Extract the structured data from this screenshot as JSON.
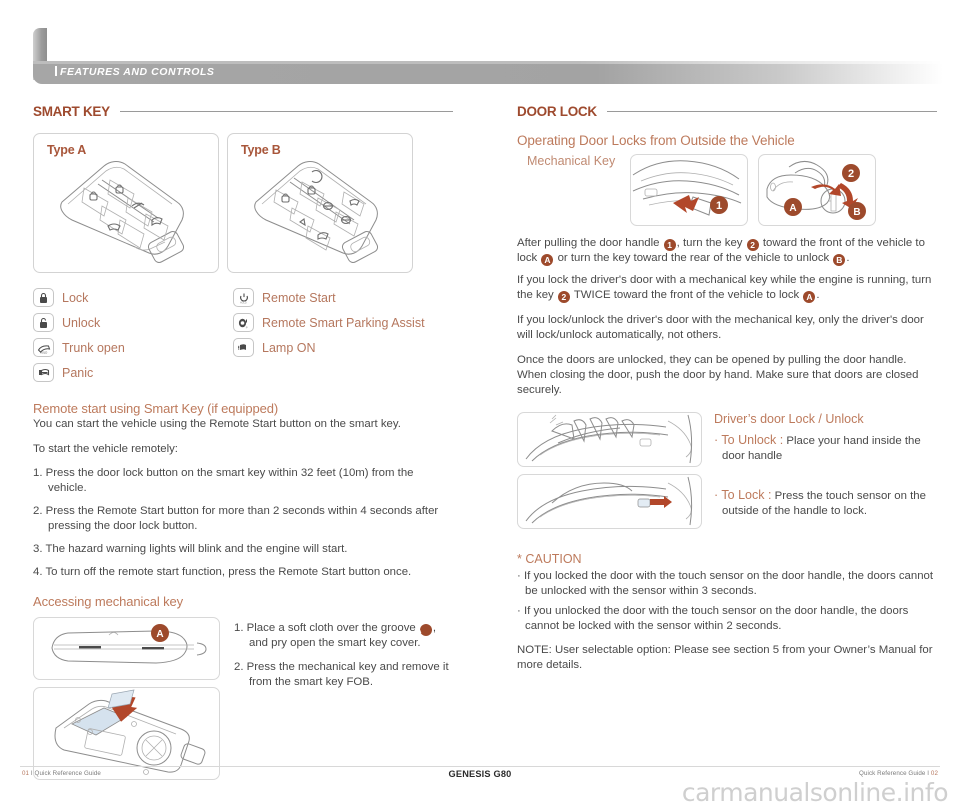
{
  "header": {
    "title": "FEATURES AND CONTROLS"
  },
  "left": {
    "section_title": "SMART KEY",
    "types": [
      {
        "label": "Type A"
      },
      {
        "label": "Type B"
      }
    ],
    "legend_col1": [
      {
        "icon": "lock-icon",
        "label": "Lock"
      },
      {
        "icon": "unlock-icon",
        "label": "Unlock"
      },
      {
        "icon": "trunk-open-icon",
        "label": "Trunk open"
      },
      {
        "icon": "panic-horn-icon",
        "label": "Panic"
      }
    ],
    "legend_col2": [
      {
        "icon": "remote-start-icon",
        "label": "Remote Start"
      },
      {
        "icon": "remote-smart-parking-assist-icon",
        "label": "Remote Smart Parking Assist"
      },
      {
        "icon": "lamp-on-icon",
        "label": "Lamp ON"
      }
    ],
    "remote_start": {
      "heading": "Remote start using Smart Key (if equipped)",
      "intro": "You can start the vehicle using the Remote Start button on the smart key.",
      "lead": "To start the vehicle remotely:",
      "steps": [
        "1. Press the door lock button on the smart key within 32 feet (10m) from the vehicle.",
        "2. Press the Remote Start button for more than 2 seconds within 4 seconds after pressing the door lock button.",
        "3. The hazard warning lights will blink and the engine will start.",
        "4. To turn off the remote start function, press the Remote Start button once."
      ]
    },
    "mechanical": {
      "heading": "Accessing mechanical key",
      "fig_badge": "A",
      "step1_pre": "1. Place a soft cloth over the groove",
      "step1_badge": "A",
      "step1_post": ", and pry open the smart key cover.",
      "step2": "2. Press the mechanical key and remove it from the smart key FOB."
    }
  },
  "right": {
    "section_title": "DOOR LOCK",
    "operating_title": "Operating Door Locks from Outside the Vehicle",
    "mechanical_key_label": "Mechanical Key",
    "fig_badges": {
      "one": "1",
      "two": "2",
      "a": "A",
      "b": "B"
    },
    "para1": {
      "t1": "After pulling the door handle ",
      "b1": "1",
      "t2": ", turn the key ",
      "b2": "2",
      "t3": " toward the front of the vehicle to lock ",
      "b3": "A",
      "t4": " or turn the key toward the rear of the vehicle to unlock ",
      "b4": "B",
      "t5": "."
    },
    "para2": {
      "t1": "If you lock the driver's door with a mechanical key while the engine is running, turn the key ",
      "b1": "2",
      "t2": " TWICE toward the front of the vehicle to lock ",
      "b2": "A",
      "t3": "."
    },
    "para3": "If you lock/unlock the driver's door with the mechanical key, only the driver's door will lock/unlock automatically, not others.",
    "para4": "Once the doors are unlocked, they can be opened by pulling the door handle. When closing the door, push the door by hand. Make sure that doors are closed securely.",
    "handle": {
      "title": "Driver’s door Lock / Unlock",
      "unlock_key": "· To Unlock :",
      "unlock_text": " Place your hand inside the door handle",
      "lock_key": "· To Lock :",
      "lock_text": " Press the touch sensor on the outside of the handle to lock."
    },
    "caution": {
      "title": "* CAUTION",
      "items": [
        "· If you locked the door with the touch sensor on the door handle, the doors cannot be unlocked with the sensor within 3 seconds.",
        "· If you unlocked the door with the touch sensor on the door handle, the doors cannot be locked with the sensor within 2 seconds."
      ],
      "note": "NOTE: User selectable option: Please see section 5 from your Owner’s Manual for more details."
    }
  },
  "footer": {
    "left_num": "01",
    "left_text": " I Quick Reference Guide",
    "center": "GENESIS G80",
    "right_text": "Quick Reference Guide I ",
    "right_num": "02",
    "watermark": "carmanualsonline.info"
  },
  "colors": {
    "accent": "#9e4a2e",
    "accent_light": "#bd7a5c",
    "banner": "#a6a6a6",
    "badge": "#9d4a2c"
  }
}
